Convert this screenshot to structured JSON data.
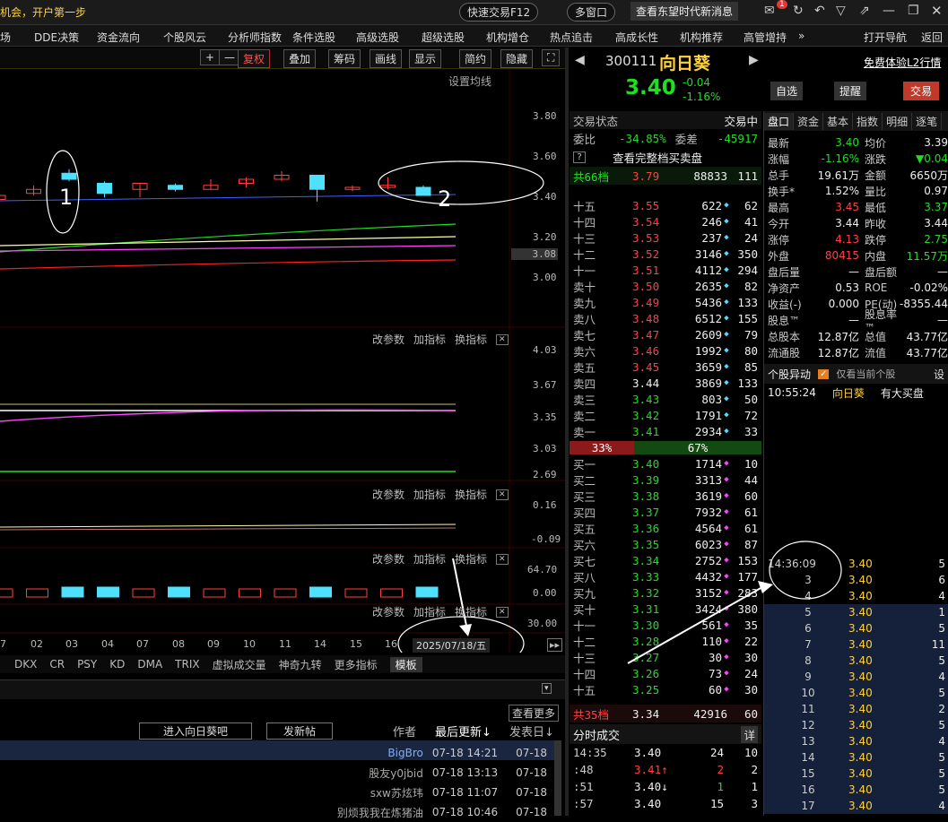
{
  "titlebar": {
    "news": "机会，开户第一步",
    "quick": "快速交易F12",
    "multi": "多窗口",
    "notice": "查看东望时代新消息",
    "badge": "1"
  },
  "menu": [
    "场",
    "DDE决策",
    "资金流向",
    "个股风云",
    "分析师指数",
    "条件选股",
    "高级选股",
    "超级选股",
    "机构增仓",
    "热点追击",
    "高成长性",
    "机构推荐",
    "高管增持",
    "»",
    "打开导航",
    "返回"
  ],
  "toolbar": [
    "复权",
    "叠加",
    "筹码",
    "画线",
    "显示",
    "简约",
    "隐藏"
  ],
  "chart_main": {
    "setting": "设置均线",
    "y_ticks": [
      "3.80",
      "3.60",
      "3.40",
      "3.20",
      "3.08",
      "3.00"
    ],
    "annot1": "1",
    "annot2": "2",
    "candles": [
      {
        "o": 3.38,
        "c": 3.4,
        "h": 3.41,
        "l": 3.37,
        "up": true
      },
      {
        "o": 3.41,
        "c": 3.43,
        "h": 3.45,
        "l": 3.4,
        "up": true
      },
      {
        "o": 3.48,
        "c": 3.51,
        "h": 3.53,
        "l": 3.47,
        "up": false
      },
      {
        "o": 3.46,
        "c": 3.41,
        "h": 3.47,
        "l": 3.39,
        "up": false
      },
      {
        "o": 3.43,
        "c": 3.46,
        "h": 3.46,
        "l": 3.39,
        "up": true
      },
      {
        "o": 3.45,
        "c": 3.43,
        "h": 3.46,
        "l": 3.42,
        "up": false
      },
      {
        "o": 3.43,
        "c": 3.45,
        "h": 3.48,
        "l": 3.43,
        "up": true
      },
      {
        "o": 3.46,
        "c": 3.48,
        "h": 3.49,
        "l": 3.44,
        "up": true
      },
      {
        "o": 3.48,
        "c": 3.5,
        "h": 3.52,
        "l": 3.47,
        "up": true
      },
      {
        "o": 3.5,
        "c": 3.43,
        "h": 3.5,
        "l": 3.37,
        "up": false
      },
      {
        "o": 3.44,
        "c": 3.43,
        "h": 3.45,
        "l": 3.42,
        "up": true
      },
      {
        "o": 3.44,
        "c": 3.45,
        "h": 3.49,
        "l": 3.43,
        "up": true
      },
      {
        "o": 3.44,
        "c": 3.4,
        "h": 3.45,
        "l": 3.4,
        "up": false
      }
    ]
  },
  "ind1": {
    "labels": [
      "改参数",
      "加指标",
      "换指标"
    ],
    "y_ticks": [
      "4.03",
      "3.67",
      "3.35",
      "3.03",
      "2.69"
    ]
  },
  "ind2": {
    "labels": [
      "改参数",
      "加指标",
      "换指标"
    ],
    "y_ticks": [
      "0.16",
      "-0.09"
    ]
  },
  "ind3": {
    "labels": [
      "改参数",
      "加指标",
      "换指标"
    ],
    "y_ticks": [
      "64.70",
      "0.00"
    ]
  },
  "ind4": {
    "labels": [
      "改参数",
      "加指标",
      "换指标"
    ],
    "y_ticks": [
      "30.00"
    ]
  },
  "x_dates": [
    "7",
    "02",
    "03",
    "04",
    "07",
    "08",
    "09",
    "10",
    "11",
    "14",
    "15",
    "16"
  ],
  "cursor_date": "2025/07/18/五",
  "ind_tabs": [
    "DKX",
    "CR",
    "PSY",
    "KD",
    "DMA",
    "TRIX",
    "虚拟成交量",
    "神奇九转",
    "更多指标",
    "模板"
  ],
  "forum": {
    "more": "查看更多",
    "enter": "进入向日葵吧",
    "post": "发新帖",
    "cols": [
      "作者",
      "最后更新↓",
      "发表日↓"
    ],
    "rows": [
      {
        "author": "BigBro",
        "upd": "07-18 14:21",
        "pub": "07-18"
      },
      {
        "author": "股友y0jbid",
        "upd": "07-18 13:13",
        "pub": "07-18"
      },
      {
        "author": "sxw苏炫玮",
        "upd": "07-18 11:07",
        "pub": "07-18"
      },
      {
        "author": "别烦我我在炼猪油",
        "upd": "07-18 10:46",
        "pub": "07-18"
      }
    ]
  },
  "stock": {
    "code": "300111",
    "name": "向日葵",
    "price": "3.40",
    "chg": "-0.04",
    "pct": "-1.16%",
    "l2": "免费体验L2行情",
    "zixuan": "自选",
    "tixing": "提醒",
    "jiaoyi": "交易"
  },
  "ob_head": {
    "state_label": "交易状态",
    "state": "交易中",
    "wb_label": "委比",
    "wb": "-34.85%",
    "wc_label": "委差",
    "wc": "-45917",
    "full": "查看完整档买卖盘",
    "q": "?",
    "sell_total_label": "共66档",
    "sell_total_p": "3.79",
    "sell_total_v": "88833",
    "sell_total_n": "111"
  },
  "sells": [
    [
      "十五",
      "3.55",
      "622",
      "62"
    ],
    [
      "十四",
      "3.54",
      "246",
      "41"
    ],
    [
      "十三",
      "3.53",
      "237",
      "24"
    ],
    [
      "十二",
      "3.52",
      "3146",
      "350"
    ],
    [
      "十一",
      "3.51",
      "4112",
      "294"
    ],
    [
      "卖十",
      "3.50",
      "2635",
      "82"
    ],
    [
      "卖九",
      "3.49",
      "5436",
      "133"
    ],
    [
      "卖八",
      "3.48",
      "6512",
      "155"
    ],
    [
      "卖七",
      "3.47",
      "2609",
      "79"
    ],
    [
      "卖六",
      "3.46",
      "1992",
      "80"
    ],
    [
      "卖五",
      "3.45",
      "3659",
      "85"
    ],
    [
      "卖四",
      "3.44",
      "3869",
      "133"
    ],
    [
      "卖三",
      "3.43",
      "803",
      "50"
    ],
    [
      "卖二",
      "3.42",
      "1791",
      "72"
    ],
    [
      "卖一",
      "3.41",
      "2934",
      "33"
    ]
  ],
  "ratio": {
    "left": "33%",
    "right": "67%"
  },
  "buys": [
    [
      "买一",
      "3.40",
      "1714",
      "10"
    ],
    [
      "买二",
      "3.39",
      "3313",
      "44"
    ],
    [
      "买三",
      "3.38",
      "3619",
      "60"
    ],
    [
      "买四",
      "3.37",
      "7932",
      "61"
    ],
    [
      "买五",
      "3.36",
      "4564",
      "61"
    ],
    [
      "买六",
      "3.35",
      "6023",
      "87"
    ],
    [
      "买七",
      "3.34",
      "2752",
      "153"
    ],
    [
      "买八",
      "3.33",
      "4432",
      "177"
    ],
    [
      "买九",
      "3.32",
      "3152",
      "283"
    ],
    [
      "买十",
      "3.31",
      "3424",
      "380"
    ],
    [
      "十一",
      "3.30",
      "561",
      "35"
    ],
    [
      "十二",
      "3.28",
      "110",
      "22"
    ],
    [
      "十三",
      "3.27",
      "30",
      "30"
    ],
    [
      "十四",
      "3.26",
      "73",
      "24"
    ],
    [
      "十五",
      "3.25",
      "60",
      "30"
    ]
  ],
  "buy_total": {
    "label": "共35档",
    "p": "3.34",
    "v": "42916",
    "n": "60"
  },
  "tick": {
    "title": "分时成交",
    "btn": "详",
    "rows": [
      [
        "14:35",
        "3.40",
        "24",
        "10"
      ],
      [
        ":48",
        "3.41↑",
        "2",
        "2"
      ],
      [
        ":51",
        "3.40↓",
        "1",
        "1"
      ],
      [
        ":57",
        "3.40",
        "15",
        "3"
      ]
    ]
  },
  "tabs": [
    "盘口",
    "资金",
    "基本",
    "指数",
    "明细",
    "逐笔"
  ],
  "stats": [
    [
      "最新",
      "3.40",
      "均价",
      "3.39"
    ],
    [
      "涨幅",
      "-1.16%",
      "涨跌",
      "▼0.04"
    ],
    [
      "总手",
      "19.61万",
      "金额",
      "6650万"
    ],
    [
      "换手*",
      "1.52%",
      "量比",
      "0.97"
    ],
    [
      "最高",
      "3.45",
      "最低",
      "3.37"
    ],
    [
      "今开",
      "3.44",
      "昨收",
      "3.44"
    ],
    [
      "涨停",
      "4.13",
      "跌停",
      "2.75"
    ],
    [
      "外盘",
      "80415",
      "内盘",
      "11.57万"
    ],
    [
      "盘后量",
      "—",
      "盘后额",
      "—"
    ],
    [
      "净资产",
      "0.53",
      "ROE",
      "-0.02%"
    ],
    [
      "收益(-)",
      "0.000",
      "PE(动)",
      "-8355.44"
    ],
    [
      "股息™",
      "—",
      "股息率™",
      "—"
    ],
    [
      "总股本",
      "12.87亿",
      "总值",
      "43.77亿"
    ],
    [
      "流通股",
      "12.87亿",
      "流值",
      "43.77亿"
    ]
  ],
  "movers": {
    "title": "个股异动",
    "only": "仅看当前个股",
    "set": "设",
    "time": "10:55:24",
    "name": "向日葵",
    "event": "有大买盘"
  },
  "trades": [
    [
      "14:36:09",
      "3.40",
      "5"
    ],
    [
      "3",
      "3.40",
      "6"
    ],
    [
      "4",
      "3.40",
      "4"
    ],
    [
      "5",
      "3.40",
      "1"
    ],
    [
      "6",
      "3.40",
      "5"
    ],
    [
      "7",
      "3.40",
      "11"
    ],
    [
      "8",
      "3.40",
      "5"
    ],
    [
      "9",
      "3.40",
      "4"
    ],
    [
      "10",
      "3.40",
      "5"
    ],
    [
      "11",
      "3.40",
      "2"
    ],
    [
      "12",
      "3.40",
      "5"
    ],
    [
      "13",
      "3.40",
      "4"
    ],
    [
      "14",
      "3.40",
      "5"
    ],
    [
      "15",
      "3.40",
      "5"
    ],
    [
      "16",
      "3.40",
      "5"
    ],
    [
      "17",
      "3.40",
      "4"
    ]
  ],
  "colors": {
    "up": "#ff4040",
    "down": "#22dd22",
    "cyan": "#4de0ff"
  }
}
